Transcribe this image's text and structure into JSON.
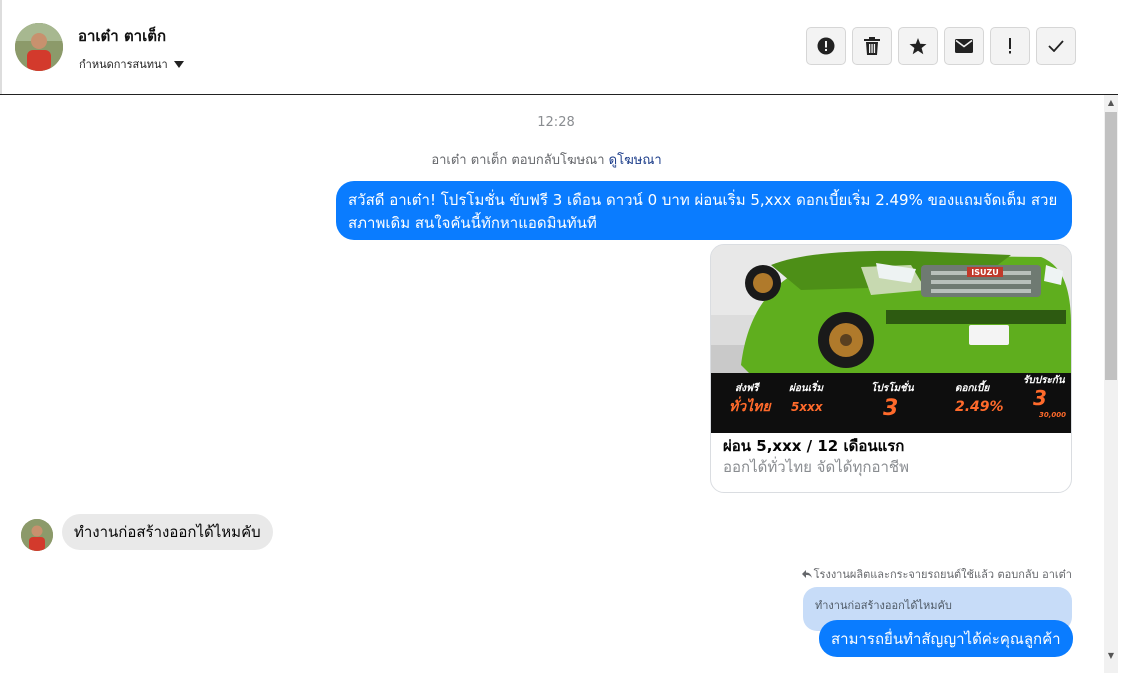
{
  "header": {
    "name": "อาเต๋า ตาเต็ก",
    "subtitle": "กำหนดการสนทนา",
    "actions": [
      {
        "icon": "alert-circle-icon"
      },
      {
        "icon": "trash-icon"
      },
      {
        "icon": "star-icon"
      },
      {
        "icon": "mail-icon"
      },
      {
        "icon": "exclamation-icon"
      },
      {
        "icon": "check-icon"
      }
    ]
  },
  "thread": {
    "timestamp": "12:28",
    "ad_reply_text": "อาเต๋า ตาเต็ก ตอบกลับโฆษณา",
    "ad_reply_link": "ดูโฆษณา",
    "outgoing_message": "สวัสดี อาเต๋า! โปรโมชั่น ขับฟรี 3 เดือน ดาวน์ 0 บาท ผ่อนเริ่ม 5,xxx  ดอกเบี้ยเริ่ม 2.49% ของแถมจัดเต็ม สวยสภาพเดิม สนใจคันนี้ทักหาแอดมินทันที",
    "ad_card": {
      "brand": "ISUZU",
      "title": "ผ่อน 5,xxx / 12 เดือนแรก",
      "subtitle": "ออกได้ทั่วไทย จัดได้ทุกอาชีพ",
      "promo_banner": [
        {
          "top": "ส่งฟรี",
          "main": "ทั่วไทย"
        },
        {
          "top": "ผ่อนเริ่ม",
          "main": "5xxx"
        },
        {
          "top": "โปรโมชั่น",
          "main": "3"
        },
        {
          "top": "ดอกเบี้ย",
          "main": "2.49%"
        },
        {
          "top": "รับประกัน",
          "main": "3",
          "extra": "30,000"
        }
      ]
    },
    "incoming_message": "ทำงานก่อสร้างออกได้ไหมคับ",
    "reply_header": "โรงงานผลิตและกระจายรถยนต์ใช้แล้ว ตอบกลับ อาเต๋า",
    "quoted_text": "ทำงานก่อสร้างออกได้ไหมคับ",
    "reply_message": "สามารถยื่นทำสัญญาได้ค่ะคุณลูกค้า"
  },
  "colors": {
    "accent": "#0a7cff",
    "incoming_bubble": "#e9e9e9",
    "quoted_bubble": "#c7dcf8"
  }
}
